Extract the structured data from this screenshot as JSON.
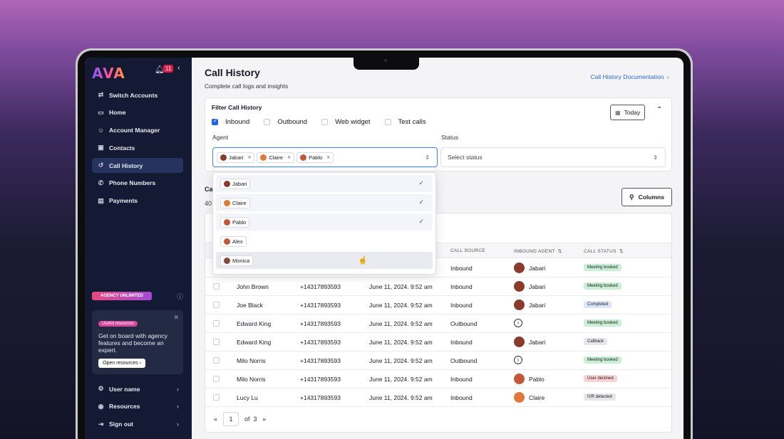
{
  "sidebar": {
    "logo": "AVA",
    "notification_count": "11",
    "items": [
      {
        "label": "Switch Accounts",
        "icon": "switch-icon"
      },
      {
        "label": "Home",
        "icon": "folder-icon"
      },
      {
        "label": "Account Manager",
        "icon": "user-icon"
      },
      {
        "label": "Contacts",
        "icon": "contacts-icon"
      },
      {
        "label": "Call History",
        "icon": "history-icon"
      },
      {
        "label": "Phone Numbers",
        "icon": "phone-icon"
      },
      {
        "label": "Payments",
        "icon": "card-icon"
      }
    ],
    "agency_tag": "AGENCY UNLIMITED",
    "resources": {
      "tag": "Useful resources",
      "text": "Get on board with agency features and become an expert.",
      "button": "Open resources"
    },
    "bottom": [
      {
        "label": "User name",
        "icon": "gear-icon"
      },
      {
        "label": "Resources",
        "icon": "globe-icon"
      },
      {
        "label": "Sign out",
        "icon": "signout-icon"
      }
    ]
  },
  "header": {
    "title": "Call History",
    "subtitle": "Complete call logs and insights",
    "doc_link": "Call History Documentation"
  },
  "filter": {
    "title": "Filter Call History",
    "checks": [
      {
        "label": "Inbound",
        "checked": true
      },
      {
        "label": "Outbound",
        "checked": false
      },
      {
        "label": "Web widget",
        "checked": false
      },
      {
        "label": "Test calls",
        "checked": false
      }
    ],
    "today": "Today",
    "agent_label": "Agent",
    "status_label": "Status",
    "agents_selected": [
      "Jabari",
      "Claire",
      "Pablo"
    ],
    "status_placeholder": "Select status"
  },
  "dropdown": {
    "options": [
      {
        "label": "Jabari",
        "selected": true
      },
      {
        "label": "Claire",
        "selected": true
      },
      {
        "label": "Pablo",
        "selected": true
      },
      {
        "label": "Alex",
        "selected": false
      },
      {
        "label": "Monica",
        "selected": false
      }
    ]
  },
  "calls": {
    "head": "Ca",
    "count": "40",
    "columns_button": "Columns"
  },
  "table": {
    "columns": [
      "CALL SOURCE",
      "INBOUND AGENT",
      "CALL STATUS"
    ],
    "rows": [
      {
        "name": "",
        "phone": "",
        "date": "",
        "source": "Inbound",
        "agent": "Jabari",
        "status": "Meeting booked"
      },
      {
        "name": "John Brown",
        "phone": "+14317893593",
        "date": "June 11, 2024. 9:52 am",
        "source": "Inbound",
        "agent": "Jabari",
        "status": "Meeting booked"
      },
      {
        "name": "Joe Black",
        "phone": "+14317893593",
        "date": "June 11, 2024. 9:52 am",
        "source": "Inbound",
        "agent": "Jabari",
        "status": "Completed"
      },
      {
        "name": "Edward King",
        "phone": "+14317893593",
        "date": "June 11, 2024. 9:52 am",
        "source": "Outbound",
        "agent": "",
        "status": "Meeting booked"
      },
      {
        "name": "Edward King",
        "phone": "+14317893593",
        "date": "June 11, 2024. 9:52 am",
        "source": "Inbound",
        "agent": "Jabari",
        "status": "Callback"
      },
      {
        "name": "Milo Norris",
        "phone": "+14317893593",
        "date": "June 11, 2024. 9:52 am",
        "source": "Outbound",
        "agent": "",
        "status": "Meeting booked"
      },
      {
        "name": "Milo Norris",
        "phone": "+14317893593",
        "date": "June 11, 2024. 9:52 am",
        "source": "Inbound",
        "agent": "Pablo",
        "status": "User declined"
      },
      {
        "name": "Lucy Lu",
        "phone": "+14317893593",
        "date": "June 11, 2024. 9:52 am",
        "source": "Inbound",
        "agent": "Claire",
        "status": "IVR detected"
      }
    ]
  },
  "pager": {
    "prev": "«",
    "page": "1",
    "of": "of",
    "total": "3",
    "next": "»"
  },
  "colors": {
    "meeting_booked": "#c9f0d4",
    "completed": "#dbe6fb",
    "callback": "#e6e6ea",
    "user_declined": "#fbd3d3",
    "ivr_detected": "#e6e6ea",
    "avatar_jabari": "#8a3b2a",
    "avatar_claire": "#e07a3b",
    "avatar_pablo": "#c2573a",
    "avatar_alex": "#c2573a",
    "avatar_monica": "#8a4a3a"
  }
}
